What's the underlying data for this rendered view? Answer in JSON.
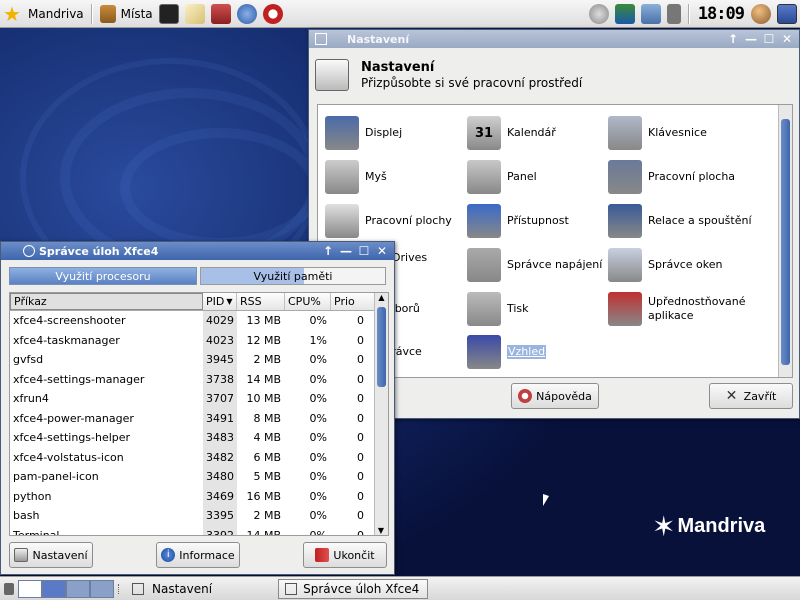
{
  "topbar": {
    "menu_label": "Mandriva",
    "places_label": "Místa",
    "clock": "18:09"
  },
  "desktop": {
    "logo_text": "Mandriva"
  },
  "settings_window": {
    "title": "Nastavení",
    "header_title": "Nastavení",
    "header_subtitle": "Přizpůsobte si své pracovní prostředí",
    "items": [
      {
        "label": "Displej",
        "icon": "display-icon"
      },
      {
        "label": "Kalendář",
        "icon": "calendar-icon",
        "icon_text": "31"
      },
      {
        "label": "Klávesnice",
        "icon": "keyboard-icon"
      },
      {
        "label": "Myš",
        "icon": "mouse-icon"
      },
      {
        "label": "Panel",
        "icon": "panel-icon"
      },
      {
        "label": "Pracovní plocha",
        "icon": "desktop-icon"
      },
      {
        "label": "Pracovní plochy",
        "icon": "workspaces-icon"
      },
      {
        "label": "Přístupnost",
        "icon": "accessibility-icon"
      },
      {
        "label": "Relace a spouštění",
        "icon": "session-icon"
      },
      {
        "label": "able Drives",
        "label2": "edia",
        "icon": "removable-drives-icon"
      },
      {
        "label": "Správce napájení",
        "icon": "power-manager-icon"
      },
      {
        "label": "Správce oken",
        "icon": "window-manager-icon"
      },
      {
        "label": "e souborů",
        "icon": "file-manager-icon"
      },
      {
        "label": "Tisk",
        "icon": "printer-icon"
      },
      {
        "label": "Upřednostňované",
        "label2": "aplikace",
        "icon": "preferred-apps-icon"
      },
      {
        "label": "ní správce",
        "icon": "window-manager-tweaks-icon"
      },
      {
        "label": "Vzhled",
        "icon": "appearance-icon"
      }
    ],
    "help_button": "Nápověda",
    "close_button": "Zavřít"
  },
  "taskmanager_window": {
    "title": "Správce úloh Xfce4",
    "cpu_label": "Využití procesoru",
    "mem_label": "Využití paměti",
    "columns": [
      "Příkaz",
      "PID",
      "RSS",
      "CPU%",
      "Prio"
    ],
    "rows": [
      [
        "xfce4-screenshooter",
        "4029",
        "13 MB",
        "0%",
        "0"
      ],
      [
        "xfce4-taskmanager",
        "4023",
        "12 MB",
        "1%",
        "0"
      ],
      [
        "gvfsd",
        "3945",
        "2 MB",
        "0%",
        "0"
      ],
      [
        "xfce4-settings-manager",
        "3738",
        "14 MB",
        "0%",
        "0"
      ],
      [
        "xfrun4",
        "3707",
        "10 MB",
        "0%",
        "0"
      ],
      [
        "xfce4-power-manager",
        "3491",
        "8 MB",
        "0%",
        "0"
      ],
      [
        "xfce4-settings-helper",
        "3483",
        "4 MB",
        "0%",
        "0"
      ],
      [
        "xfce4-volstatus-icon",
        "3482",
        "6 MB",
        "0%",
        "0"
      ],
      [
        "pam-panel-icon",
        "3480",
        "5 MB",
        "0%",
        "0"
      ],
      [
        "python",
        "3469",
        "16 MB",
        "0%",
        "0"
      ],
      [
        "bash",
        "3395",
        "2 MB",
        "0%",
        "0"
      ],
      [
        "Terminal",
        "3392",
        "14 MB",
        "0%",
        "0"
      ]
    ],
    "settings_button": "Nastavení",
    "info_button": "Informace",
    "quit_button": "Ukončit"
  },
  "bottombar": {
    "task1": "Nastavení",
    "task2": "Správce úloh Xfce4"
  }
}
